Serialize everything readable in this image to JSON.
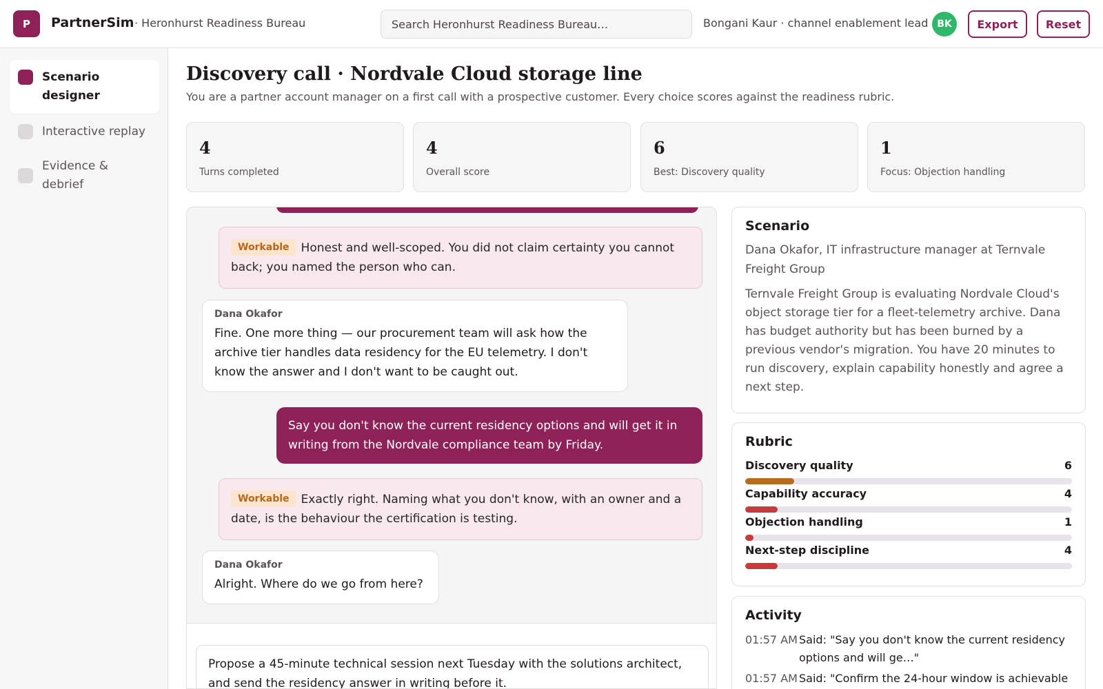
{
  "header": {
    "logo_letter": "P",
    "app_name": "PartnerSim",
    "org": "· Heronhurst Readiness Bureau",
    "search_placeholder": "Search Heronhurst Readiness Bureau…",
    "user": "Bongani Kaur · channel enablement lead",
    "avatar_initials": "BK",
    "export_label": "Export",
    "reset_label": "Reset"
  },
  "sidebar": {
    "items": [
      {
        "label": "Scenario designer",
        "active": true
      },
      {
        "label": "Interactive replay",
        "active": false
      },
      {
        "label": "Evidence & debrief",
        "active": false
      }
    ]
  },
  "main": {
    "title": "Discovery call · Nordvale Cloud storage line",
    "subtitle": "You are a partner account manager on a first call with a prospective customer. Every choice scores against the readiness rubric."
  },
  "stats": [
    {
      "value": "4",
      "label": "Turns completed"
    },
    {
      "value": "4",
      "label": "Overall score"
    },
    {
      "value": "6",
      "label": "Best: Discovery quality"
    },
    {
      "value": "1",
      "label": "Focus: Objection handling"
    }
  ],
  "chat": {
    "feedback_1": {
      "badge": "Workable",
      "text": "Honest and well-scoped. You did not claim certainty you cannot back; you named the person who can."
    },
    "customer_1": {
      "name": "Dana Okafor",
      "text": "Fine. One more thing — our procurement team will ask how the archive tier handles data residency for the EU telemetry. I don't know the answer and I don't want to be caught out."
    },
    "reply_1": "Say you don't know the current residency options and will get it in writing from the Nordvale compliance team by Friday.",
    "feedback_2": {
      "badge": "Workable",
      "text": "Exactly right. Naming what you don't know, with an owner and a date, is the behaviour the certification is testing."
    },
    "customer_2": {
      "name": "Dana Okafor",
      "text": "Alright. Where do we go from here?"
    },
    "composer": "Propose a 45-minute technical session next Tuesday with the solutions architect, and send the residency answer in writing before it."
  },
  "scenario": {
    "title": "Scenario",
    "persona": "Dana Okafor, IT infrastructure manager at Ternvale Freight Group",
    "description": "Ternvale Freight Group is evaluating Nordvale Cloud's object storage tier for a fleet-telemetry archive. Dana has budget authority but has been burned by a previous vendor's migration. You have 20 minutes to run discovery, explain capability honestly and agree a next step."
  },
  "rubric": {
    "title": "Rubric",
    "max": 100,
    "items": [
      {
        "name": "Discovery quality",
        "score": 6,
        "color": "#b86a1e"
      },
      {
        "name": "Capability accuracy",
        "score": 4,
        "color": "#c63b3e"
      },
      {
        "name": "Objection handling",
        "score": 1,
        "color": "#c63b3e"
      },
      {
        "name": "Next-step discipline",
        "score": 4,
        "color": "#c63b3e"
      }
    ]
  },
  "activity": {
    "title": "Activity",
    "items": [
      {
        "time": "01:57 AM",
        "text": "Said: \"Say you don't know the current residency options and will ge…\""
      },
      {
        "time": "01:57 AM",
        "text": "Said: \"Confirm the 24-hour window is achievable"
      }
    ]
  },
  "colors": {
    "brand": "#8e2158",
    "avatar": "#2fb86a",
    "badge_text": "#b8671a",
    "badge_bg": "#fbe5cf"
  }
}
